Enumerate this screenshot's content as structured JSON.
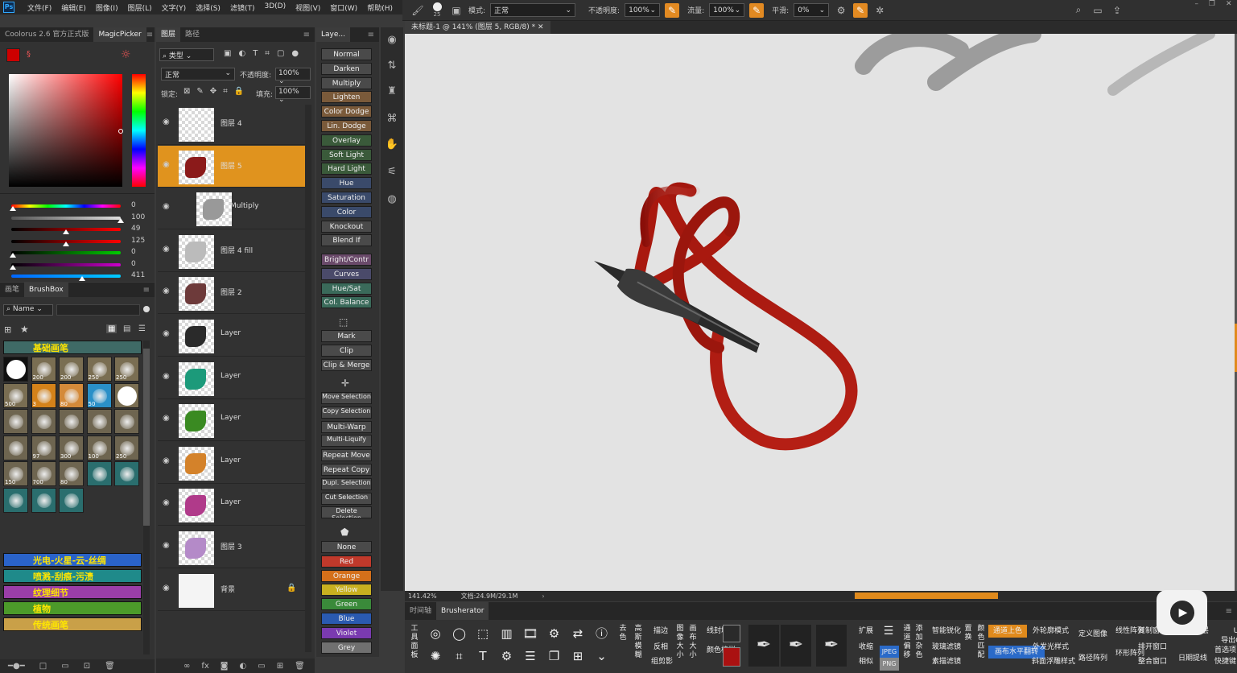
{
  "menu": [
    "文件(F)",
    "编辑(E)",
    "图像(I)",
    "图层(L)",
    "文字(Y)",
    "选择(S)",
    "滤镜(T)",
    "3D(D)",
    "视图(V)",
    "窗口(W)",
    "帮助(H)"
  ],
  "options": {
    "brush_size": "25",
    "mode_label": "模式:",
    "mode_value": "正常",
    "opacity_label": "不透明度:",
    "opacity_value": "100%",
    "flow_label": "流量:",
    "flow_value": "100%",
    "smooth_label": "平滑:",
    "smooth_value": "0%"
  },
  "document_tab": "未标题-1 @ 141% (图层 5, RGB/8) *",
  "color_panel": {
    "tabs": [
      "Coolorus 2.6 官方正式版",
      "MagicPicker"
    ],
    "foreground": "#cc0000",
    "values": [
      "0",
      "100",
      "49",
      "125",
      "0",
      "0",
      "411"
    ]
  },
  "brush_panel": {
    "tabs": [
      "画笔",
      "BrushBox"
    ],
    "filter_label": "Name",
    "brush_labels": [
      "200",
      "200",
      "250",
      "250",
      "500",
      "3",
      "80",
      "50",
      "97",
      "300",
      "100",
      "250",
      "150",
      "700",
      "80"
    ],
    "groups": [
      {
        "name": "基础画笔",
        "color": "#3f6a66"
      },
      {
        "name": "光电-火星-云-丝绸",
        "color": "#2a63c9"
      },
      {
        "name": "喷溅-刮痕-污渍",
        "color": "#1f8a8a"
      },
      {
        "name": "纹理细节",
        "color": "#9a3ea8"
      },
      {
        "name": "植物",
        "color": "#4c9a2a"
      },
      {
        "name": "传统画笔",
        "color": "#c9a048"
      }
    ]
  },
  "layers_panel": {
    "tabs": [
      "图层",
      "路径"
    ],
    "filter_kind": "类型",
    "blend_mode": "正常",
    "opacity_label": "不透明度:",
    "opacity_value": "100%",
    "lock_label": "锁定:",
    "fill_label": "填充:",
    "fill_value": "100%",
    "layers": [
      {
        "name": "图层 4",
        "selected": false
      },
      {
        "name": "图层 5",
        "selected": true
      },
      {
        "name": "Multiply",
        "selected": false
      },
      {
        "name": "图层 4 fill",
        "selected": false
      },
      {
        "name": "图层 2",
        "selected": false
      },
      {
        "name": "Layer",
        "selected": false
      },
      {
        "name": "Layer",
        "selected": false
      },
      {
        "name": "Layer",
        "selected": false
      },
      {
        "name": "Layer",
        "selected": false
      },
      {
        "name": "Layer",
        "selected": false
      },
      {
        "name": "图层 3",
        "selected": false
      },
      {
        "name": "背景",
        "selected": false
      }
    ]
  },
  "layer_actions": {
    "title": "Laye...",
    "blend_modes": [
      "Normal",
      "Darken",
      "Multiply",
      "Lighten",
      "Color Dodge",
      "Lin. Dodge",
      "Overlay",
      "Soft Light",
      "Hard Light",
      "Hue",
      "Saturation",
      "Color",
      "Knockout",
      "Blend If"
    ],
    "adjustments": [
      "Bright/Contr",
      "Curves",
      "Hue/Sat",
      "Col. Balance"
    ],
    "mark_actions": [
      "Mark",
      "Clip",
      "Clip & Merge"
    ],
    "selection_actions": [
      "Move Selection",
      "Copy Selection",
      "Multi-Warp",
      "Multi-Liquify",
      "Repeat Move",
      "Repeat Copy",
      "Dupl. Selection",
      "Cut Selection",
      "Delete Selection"
    ],
    "colors": [
      "None",
      "Red",
      "Orange",
      "Yellow",
      "Green",
      "Blue",
      "Violet",
      "Grey"
    ]
  },
  "status": {
    "zoom": "141.42%",
    "doc_size": "文档:24.9M/29.1M"
  },
  "bottom_panel": {
    "tabs": [
      "时间轴",
      "Brusherator"
    ],
    "vertical_labels": [
      "工具面板",
      "去色",
      "高斯模糊",
      "描边",
      "反相",
      "组剪影",
      "图像大小",
      "画布大小",
      "线封填充",
      "颜色校样",
      "扩展",
      "收缩",
      "相似",
      "通道偏移",
      "添加杂色",
      "智能锐化",
      "玻璃滤镜",
      "素描滤镜",
      "置换",
      "颜色匹配",
      "通道上色",
      "画布水平翻转",
      "外轮廓模式",
      "外发光样式",
      "斜面浮雕样式",
      "定义图像",
      "路径阵列",
      "线性阵列",
      "环形阵列",
      "复制窗口",
      "排开窗口",
      "整合窗口",
      "新建图层",
      "日期提线",
      "UI-color",
      "导出GIF",
      "首选项",
      "快捷键"
    ],
    "format_labels": [
      "JPEG",
      "PNG"
    ],
    "swatch_top": "#2a2a2a",
    "swatch_bottom": "#aa1111"
  }
}
